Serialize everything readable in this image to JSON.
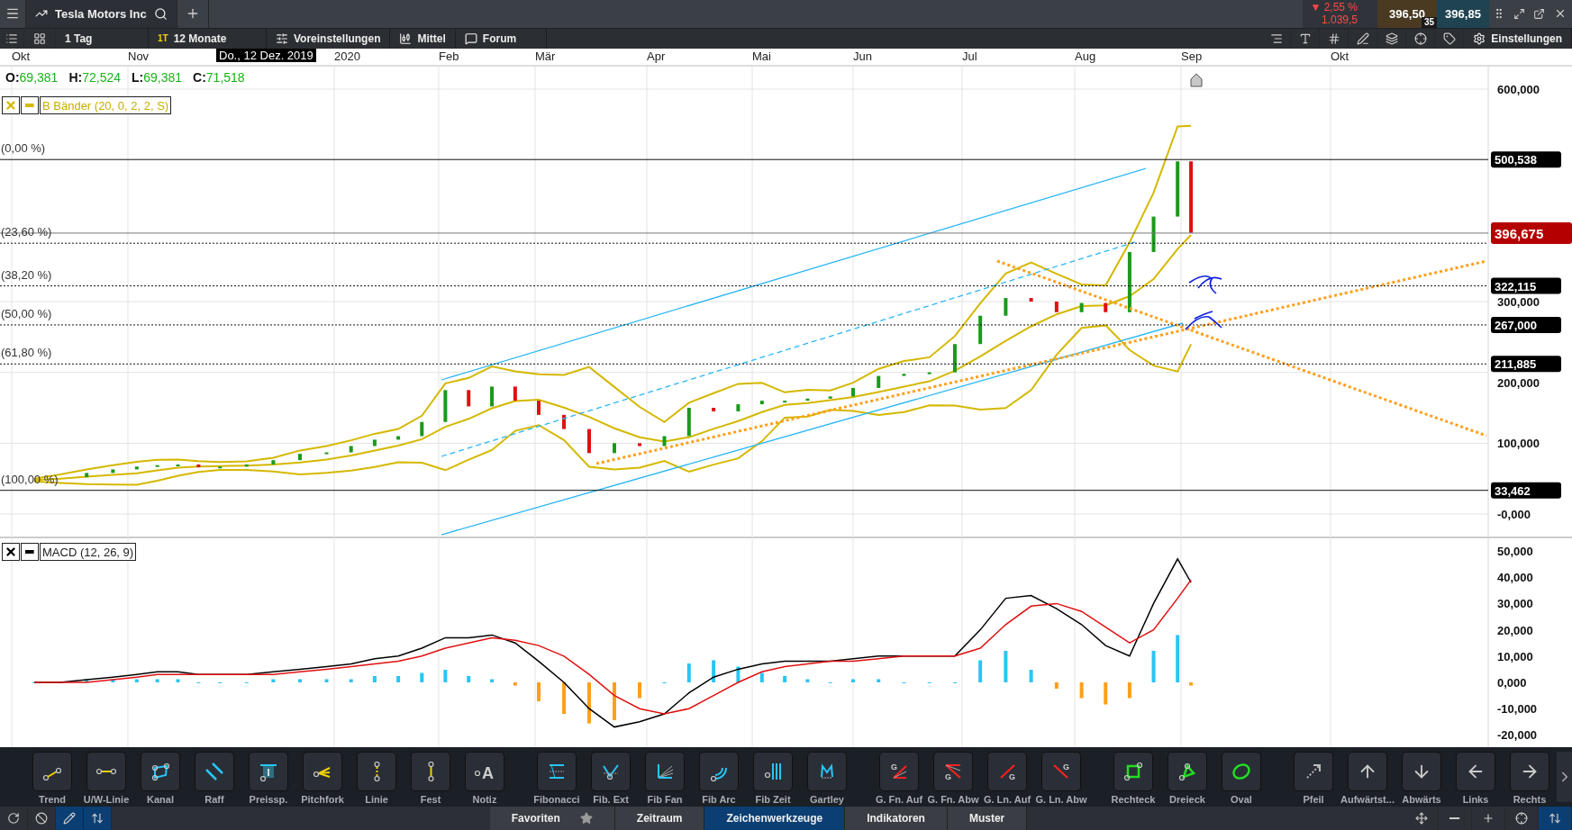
{
  "window": {
    "tab_title": "Tesla Motors Inc",
    "change": "▼ 2,55 %",
    "change_abs": "1.039,5",
    "bid": "396,50",
    "ask": "396,85",
    "spread": "35"
  },
  "toolbar": {
    "interval": "1 Tag",
    "range_badge": "1T",
    "range": "12 Monate",
    "presets": "Voreinstellungen",
    "style": "Mittel",
    "forum": "Forum",
    "settings": "Einstellungen"
  },
  "time_axis": {
    "months": [
      "Okt",
      "Nov",
      "2020",
      "Feb",
      "Mär",
      "Apr",
      "Mai",
      "Jun",
      "Jul",
      "Aug",
      "Sep",
      "Okt"
    ],
    "cursor_label": "Do., 12 Dez. 2019"
  },
  "ohlc": [
    {
      "key": "O:",
      "value": "69,381"
    },
    {
      "key": "H:",
      "value": "72,524"
    },
    {
      "key": "L:",
      "value": "69,381"
    },
    {
      "key": "C:",
      "value": "71,518"
    }
  ],
  "price_panel": {
    "legend": "B Bänder (20, 0, 2, 2, S)",
    "axis_labels": [
      "600,000",
      "300,000",
      "200,000",
      "100,000",
      "-0,000"
    ],
    "fib_levels": [
      {
        "label": "(0,00 %)",
        "tag": "500,538"
      },
      {
        "label": "(23,60 %)"
      },
      {
        "label": "(38,20 %)",
        "tag": "322,115"
      },
      {
        "label": "(50,00 %)",
        "tag": "267,000"
      },
      {
        "label": "(61,80 %)",
        "tag": "211,885"
      },
      {
        "label": "(100,00 %)",
        "tag": "33,462"
      }
    ],
    "current_price": "396,675"
  },
  "macd_panel": {
    "legend": "MACD (12, 26, 9)",
    "axis_labels": [
      "50,000",
      "40,000",
      "30,000",
      "20,000",
      "10,000",
      "0,000",
      "-10,000",
      "-20,000"
    ]
  },
  "tool_groups": [
    [
      {
        "label": "Trend"
      },
      {
        "label": "U/W-Linie"
      },
      {
        "label": "Kanal"
      },
      {
        "label": "Raff"
      },
      {
        "label": "Preissp."
      },
      {
        "label": "Pitchfork"
      },
      {
        "label": "Linie"
      },
      {
        "label": "Fest"
      },
      {
        "label": "Notiz",
        "glyph": "A"
      }
    ],
    [
      {
        "label": "Fibonacci"
      },
      {
        "label": "Fib. Ext"
      },
      {
        "label": "Fib Fan"
      },
      {
        "label": "Fib Arc"
      },
      {
        "label": "Fib Zeit"
      },
      {
        "label": "Gartley"
      }
    ],
    [
      {
        "label": "G. Fn. Auf",
        "glyph": "G"
      },
      {
        "label": "G. Fn. Abw",
        "glyph": "G"
      },
      {
        "label": "G. Ln. Auf",
        "glyph": "G"
      },
      {
        "label": "G. Ln. Abw",
        "glyph": "G"
      }
    ],
    [
      {
        "label": "Rechteck"
      },
      {
        "label": "Dreieck"
      },
      {
        "label": "Oval"
      }
    ],
    [
      {
        "label": "Pfeil"
      },
      {
        "label": "Aufwärtst..."
      },
      {
        "label": "Abwärts"
      },
      {
        "label": "Links"
      },
      {
        "label": "Rechts"
      }
    ]
  ],
  "bottom_tabs": [
    {
      "label": "Favoriten",
      "selected": false
    },
    {
      "label": "Zeitraum",
      "selected": false
    },
    {
      "label": "Zeichenwerkzeuge",
      "selected": true
    },
    {
      "label": "Indikatoren",
      "selected": false
    },
    {
      "label": "Muster",
      "selected": false
    }
  ],
  "bottom_left": [
    {
      "selected": false
    },
    {
      "selected": false
    },
    {
      "selected": true
    },
    {
      "selected": true
    }
  ],
  "bottom_right": [
    {
      "selected": false
    },
    {
      "selected": false
    },
    {
      "selected": false
    },
    {
      "selected": false
    },
    {
      "selected": true
    }
  ]
}
